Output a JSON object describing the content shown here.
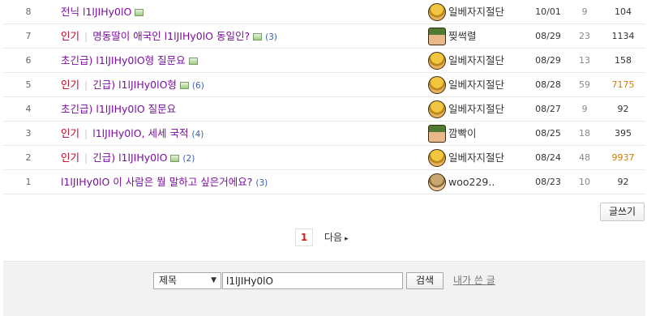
{
  "rows": [
    {
      "num": "8",
      "tag": "",
      "title": "전닉 l1lJIHy0lO",
      "pic": true,
      "comments": "",
      "writer": "일베자지절단",
      "avatar": "gold",
      "date": "10/01",
      "views": "9",
      "likes": "104",
      "hot": false
    },
    {
      "num": "7",
      "tag": "인기",
      "title": "명동딸이 애국인 l1lJIHy0lO 동일인?",
      "pic": true,
      "comments": "(3)",
      "writer": "찢썩렬",
      "avatar": "green",
      "date": "08/29",
      "views": "23",
      "likes": "1134",
      "hot": false
    },
    {
      "num": "6",
      "tag": "",
      "title": "초긴급) l1lJIHy0lO형 질문요",
      "pic": true,
      "comments": "",
      "writer": "일베자지절단",
      "avatar": "gold",
      "date": "08/29",
      "views": "13",
      "likes": "158",
      "hot": false
    },
    {
      "num": "5",
      "tag": "인기",
      "title": "긴급) l1lJIHy0lO형",
      "pic": true,
      "comments": "(6)",
      "writer": "일베자지절단",
      "avatar": "gold",
      "date": "08/28",
      "views": "59",
      "likes": "7175",
      "hot": true
    },
    {
      "num": "4",
      "tag": "",
      "title": "초긴급) l1lJIHy0lO 질문요",
      "pic": false,
      "comments": "",
      "writer": "일베자지절단",
      "avatar": "gold",
      "date": "08/27",
      "views": "9",
      "likes": "92",
      "hot": false
    },
    {
      "num": "3",
      "tag": "인기",
      "title": "l1lJIHy0lO, 세세 국적",
      "pic": false,
      "comments": "(4)",
      "writer": "깜빡이",
      "avatar": "green",
      "date": "08/25",
      "views": "18",
      "likes": "395",
      "hot": false
    },
    {
      "num": "2",
      "tag": "인기",
      "title": "긴급) l1lJIHy0lO",
      "pic": true,
      "comments": "(2)",
      "writer": "일베자지절단",
      "avatar": "gold",
      "date": "08/24",
      "views": "48",
      "likes": "9937",
      "hot": true
    },
    {
      "num": "1",
      "tag": "",
      "title": "l1lJIHy0lO 이 사람은 뭘 말하고 싶은거에요?",
      "pic": false,
      "comments": "(3)",
      "writer": "woo229..",
      "avatar": "tan",
      "date": "08/23",
      "views": "10",
      "likes": "92",
      "hot": false
    }
  ],
  "write_button": "글쓰기",
  "pagination": {
    "current": "1",
    "next_label": "다음",
    "next_icon": "▸"
  },
  "search": {
    "field_selected": "제목",
    "keyword": "l1lJIHy0lO",
    "button": "검색",
    "my_posts_link": "내가 쓴 글"
  },
  "colors": {
    "title": "#7a0f9e",
    "tag": "#c00020",
    "hot_count": "#d67a00"
  }
}
